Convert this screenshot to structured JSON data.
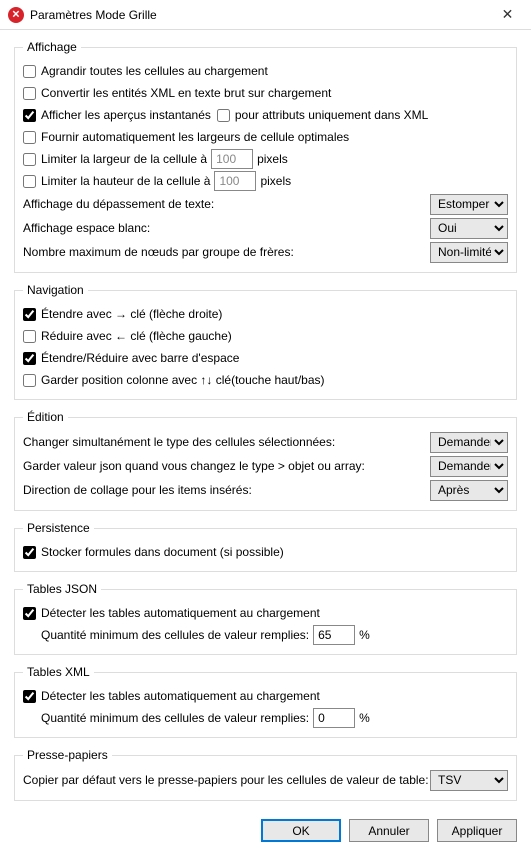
{
  "window": {
    "title": "Paramètres Mode Grille",
    "close_icon": "✕"
  },
  "groups": {
    "affichage": {
      "legend": "Affichage",
      "expand_all": "Agrandir toutes les cellules au chargement",
      "convert_xml": "Convertir les entités XML en texte brut sur chargement",
      "show_preview": "Afficher les aperçus instantanés",
      "attrs_only": "pour attributs uniquement dans XML",
      "auto_width": "Fournir automatiquement les largeurs de cellule optimales",
      "limit_width_pre": "Limiter la largeur de la cellule à",
      "limit_width_val": "100",
      "limit_height_pre": "Limiter la hauteur de la cellule à",
      "limit_height_val": "100",
      "pixels": "pixels",
      "overflow_label": "Affichage du dépassement de texte:",
      "overflow_value": "Estomper",
      "whitespace_label": "Affichage espace blanc:",
      "whitespace_value": "Oui",
      "maxnodes_label": "Nombre maximum de nœuds par groupe de frères:",
      "maxnodes_value": "Non-limité"
    },
    "navigation": {
      "legend": "Navigation",
      "expand_right": "Étendre avec → clé (flèche droite)",
      "collapse_left": "Réduire avec ← clé (flèche gauche)",
      "space_toggle": "Étendre/Réduire avec barre d'espace",
      "keep_col": "Garder position colonne avec ↑↓ clé(touche haut/bas)"
    },
    "edition": {
      "legend": "Édition",
      "change_type_label": "Changer simultanément le type des cellules sélectionnées:",
      "change_type_value": "Demander",
      "keep_json_label": "Garder valeur json quand vous changez le type > objet ou array:",
      "keep_json_value": "Demander",
      "paste_dir_label": "Direction de collage pour les items insérés:",
      "paste_dir_value": "Après"
    },
    "persistence": {
      "legend": "Persistence",
      "store_formulas": "Stocker formules dans document (si possible)"
    },
    "tables_json": {
      "legend": "Tables JSON",
      "detect": "Détecter les tables automatiquement au chargement",
      "min_label": "Quantité minimum des cellules de valeur remplies:",
      "min_val": "65",
      "pct": "%"
    },
    "tables_xml": {
      "legend": "Tables XML",
      "detect": "Détecter les tables automatiquement au chargement",
      "min_label": "Quantité minimum des cellules de valeur remplies:",
      "min_val": "0",
      "pct": "%"
    },
    "clipboard": {
      "legend": "Presse-papiers",
      "copy_label": "Copier par défaut vers le presse-papiers pour les cellules de valeur de table:",
      "copy_value": "TSV"
    }
  },
  "buttons": {
    "ok": "OK",
    "cancel": "Annuler",
    "apply": "Appliquer"
  }
}
